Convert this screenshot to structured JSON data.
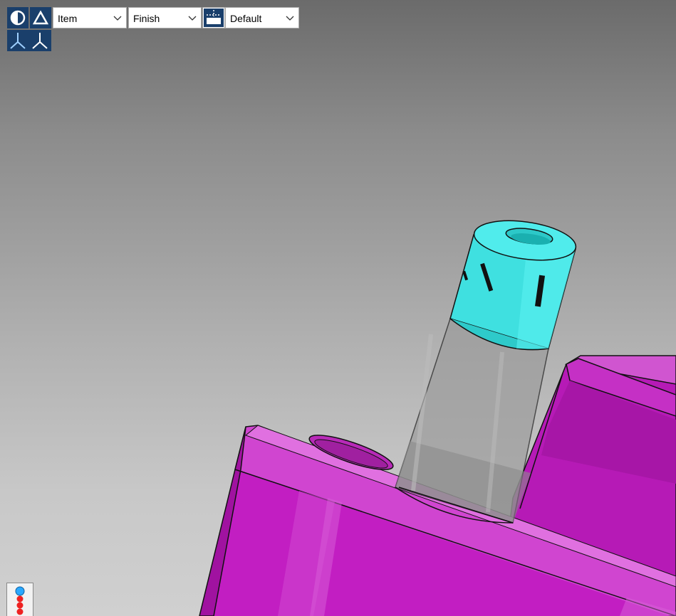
{
  "toolbar": {
    "display_mode_icon": "contrast-icon",
    "perspective_icon": "triangle-icon",
    "triad_icon": "coordinate-triad-icon",
    "view_icon": "view-orientation-icon",
    "dropdown_item": {
      "value": "Item"
    },
    "dropdown_finish": {
      "value": "Finish"
    },
    "dropdown_view": {
      "value": "Default"
    }
  },
  "legend": {
    "icon": "color-legend-icon"
  },
  "colors": {
    "toolbar_icon_bg": "#1a3f6b",
    "part_magenta": "#c61cc6",
    "part_cyan": "#3fe6e6",
    "part_transparent": "#a5a5a5"
  }
}
